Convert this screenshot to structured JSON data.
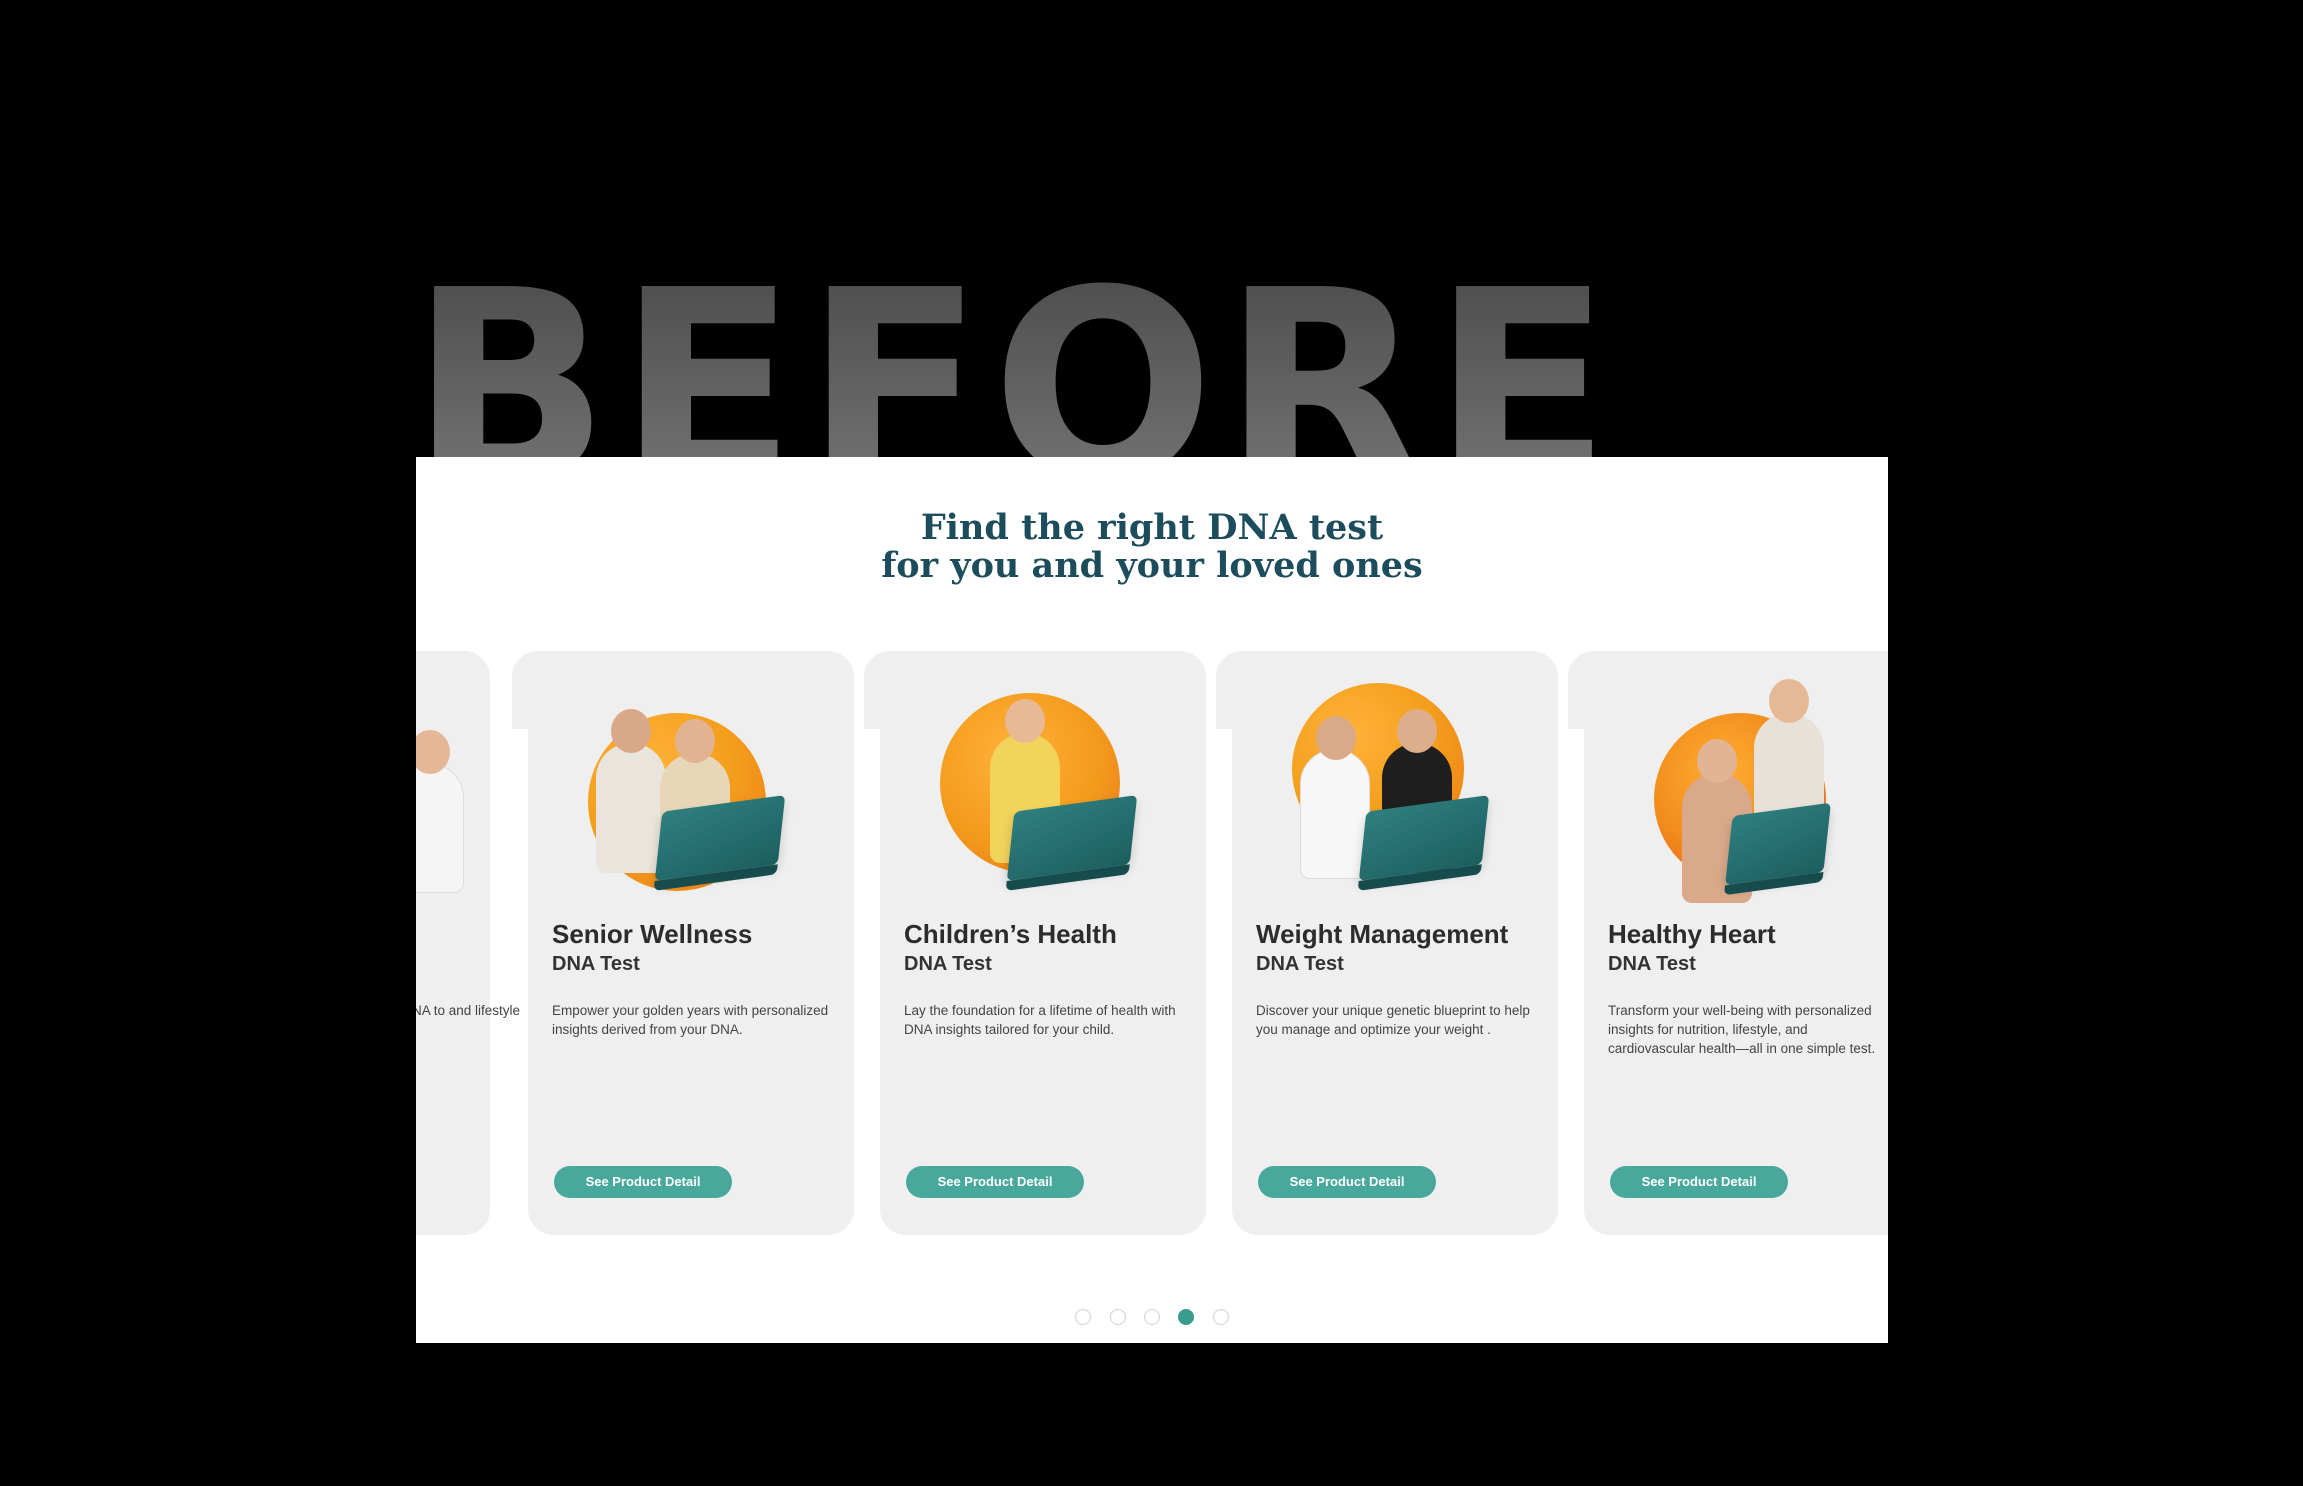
{
  "banner": {
    "label": "BEFORE"
  },
  "section": {
    "heading_line1": "Find the right DNA test",
    "heading_line2": "for you and your loved ones"
  },
  "cards": [
    {
      "title": "",
      "subtitle": "",
      "description": "NA to\n and lifestyle",
      "button": ""
    },
    {
      "title": "Senior Wellness",
      "subtitle": "DNA Test",
      "description": "Empower your golden years with personalized insights derived from your DNA.",
      "button": "See Product Detail"
    },
    {
      "title": "Children’s Health",
      "subtitle": "DNA Test",
      "description": "Lay the foundation for a lifetime of health with DNA insights tailored for your child.",
      "button": "See Product Detail"
    },
    {
      "title": "Weight Management",
      "subtitle": "DNA Test",
      "description": "Discover your unique genetic blueprint to help you manage and optimize your weight .",
      "button": "See Product Detail"
    },
    {
      "title": "Healthy Heart",
      "subtitle": "DNA Test",
      "description": "Transform your well-being with personalized insights for nutrition, lifestyle, and cardiovascular health—all in one simple test.",
      "button": "See Product Detail"
    }
  ],
  "pagination": {
    "total": 5,
    "active_index": 3
  },
  "colors": {
    "heading": "#1d4d5c",
    "button": "#48a89c",
    "card_bg": "#efefef",
    "active_dot": "#3a9b8f",
    "accent_orange": "#f4a01e"
  }
}
